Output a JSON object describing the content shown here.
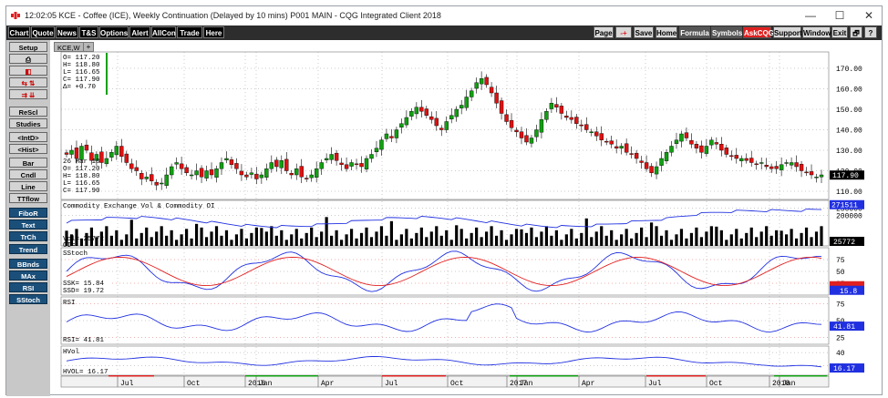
{
  "window": {
    "title": "12:02:05   KCE - Coffee (ICE), Weekly Continuation (Delayed by 10 mins)   P001 MAIN - CQG Integrated Client 2018",
    "minimize": "—",
    "maximize": "☐",
    "close": "✕"
  },
  "menu": {
    "left": [
      "Chart",
      "Quote",
      "News",
      "T&S",
      "Options",
      "Alert",
      "AllCon",
      "Trade",
      "Here"
    ],
    "right": [
      "Page",
      "-+",
      "Save",
      "Home",
      "Formula",
      "Symbols",
      "AskCQG",
      "Support",
      "Window",
      "Exit",
      "🗗",
      "?"
    ]
  },
  "sidebar": {
    "items": [
      "Setup",
      "⎙",
      "◧",
      "⇆  ⇅",
      "⇉  ⇊",
      "ReScl",
      "Studies",
      "<IntD>",
      "<Hist>",
      "Bar",
      "Cndl",
      "Line",
      "TTflow",
      "FiboR",
      "Text",
      "TrCh",
      "Trend",
      "BBnds",
      "MAx",
      "RSI",
      "SStoch"
    ]
  },
  "tab": {
    "label": "KCE,W",
    "plus": "+"
  },
  "colors": {
    "up": "#10a010",
    "down": "#e01010",
    "blue": "#2030e0",
    "red": "#e02020",
    "black": "#000000"
  },
  "chart_data": [
    {
      "type": "candlestick",
      "title": "",
      "ohlc_box": [
        "O=  117.20",
        "H=  118.80",
        "L=  116.65",
        "C=  117.90",
        "Δ=  +0.70"
      ],
      "date_box": [
        "26 Mar 18",
        "O=  117.20",
        "H=  118.80",
        "L=  116.65",
        "C=  117.90"
      ],
      "y_ticks": [
        "170.00",
        "160.00",
        "150.00",
        "140.00",
        "130.00",
        "120.00",
        "110.00"
      ],
      "ylim": [
        106,
        178
      ],
      "last_price": "117.90",
      "close_path": [
        128,
        130,
        126,
        132,
        130,
        125,
        128,
        124,
        126,
        129,
        132,
        127,
        124,
        121,
        120,
        116,
        117,
        115,
        113,
        114,
        118,
        122,
        124,
        121,
        119,
        118,
        120,
        117,
        120,
        118,
        121,
        124,
        126,
        123,
        121,
        118,
        117,
        119,
        116,
        118,
        121,
        124,
        122,
        125,
        120,
        118,
        121,
        117,
        116,
        118,
        121,
        124,
        126,
        128,
        125,
        123,
        121,
        124,
        123,
        122,
        126,
        128,
        131,
        135,
        138,
        136,
        140,
        143,
        146,
        149,
        151,
        149,
        147,
        145,
        142,
        140,
        144,
        147,
        150,
        152,
        156,
        159,
        163,
        165,
        162,
        158,
        153,
        148,
        144,
        141,
        139,
        136,
        134,
        136,
        140,
        145,
        149,
        153,
        151,
        148,
        146,
        145,
        143,
        142,
        140,
        139,
        137,
        135,
        134,
        133,
        131,
        132,
        129,
        128,
        126,
        124,
        121,
        119,
        122,
        126,
        129,
        132,
        135,
        138,
        136,
        133,
        131,
        129,
        132,
        135,
        133,
        130,
        128,
        127,
        126,
        126,
        125,
        124,
        123,
        124,
        122,
        121,
        121,
        123,
        124,
        124,
        122,
        120,
        119,
        118,
        117,
        118
      ]
    },
    {
      "type": "bar",
      "title": "Commodity Exchange Vol & Commodity OI",
      "labels": [
        "Vol=",
        "OI="
      ],
      "vol_value": "25772",
      "y_ticks": [
        "250000",
        "200000"
      ],
      "oi_last": "271511",
      "vol_last": "25772",
      "ylim": [
        0,
        300000
      ]
    },
    {
      "type": "line",
      "title": "SStoch",
      "labels": [
        "SSK=",
        "SSD="
      ],
      "ssk": "15.84",
      "ssd": "19.72",
      "y_ticks": [
        "75",
        "50",
        "25"
      ],
      "last": "15.8",
      "ylim": [
        0,
        100
      ]
    },
    {
      "type": "line",
      "title": "RSI",
      "label": "RSI=",
      "value": "41.81",
      "y_ticks": [
        "75",
        "50",
        "25"
      ],
      "last": "41.81",
      "ylim": [
        15,
        85
      ]
    },
    {
      "type": "line",
      "title": "HVol",
      "label": "HVOL=",
      "value": "16.17",
      "y_ticks": [
        "40",
        "20"
      ],
      "last": "16.17",
      "ylim": [
        5,
        50
      ]
    }
  ],
  "x_axis": {
    "labels": [
      "Jul",
      "Oct",
      "2016",
      "Jan",
      "Apr",
      "Jul",
      "Oct",
      "2017",
      "Jan",
      "Apr",
      "Jul",
      "Oct",
      "2018",
      "Jan"
    ]
  }
}
